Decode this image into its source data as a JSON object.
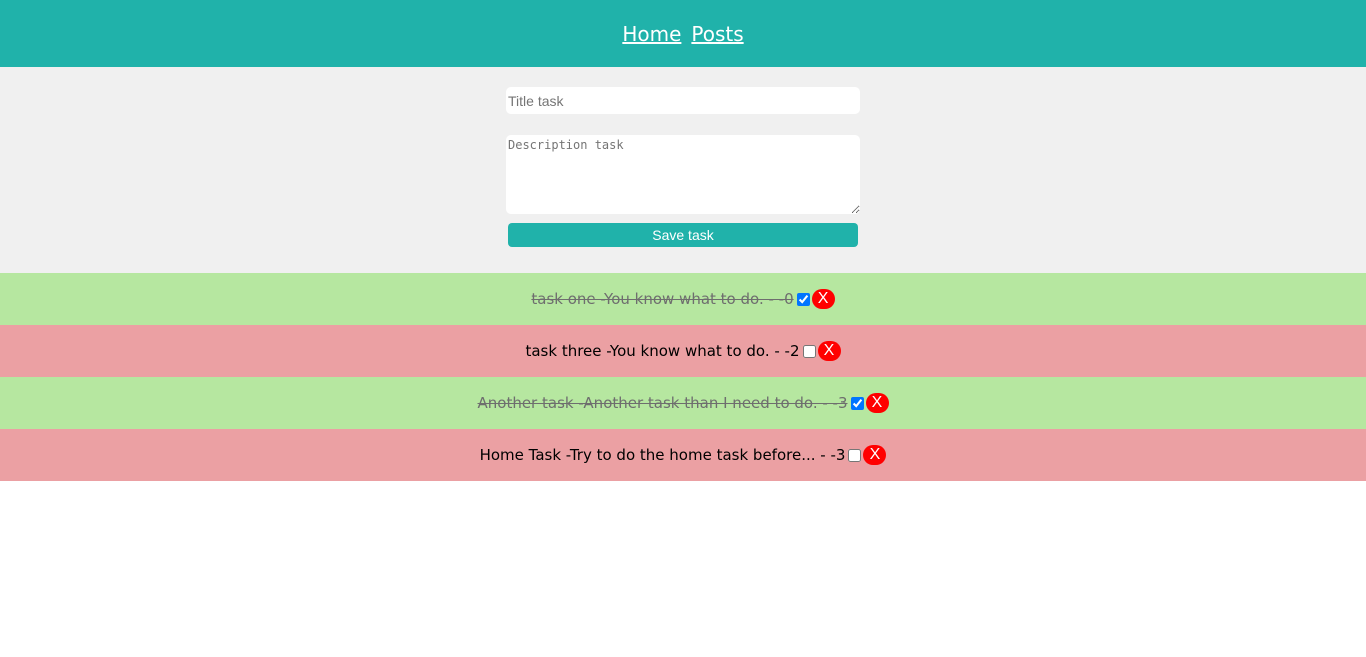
{
  "nav": {
    "home_label": "Home",
    "posts_label": "Posts"
  },
  "form": {
    "title_placeholder": "Title task",
    "description_placeholder": "Description task",
    "save_label": "Save task"
  },
  "colors": {
    "accent": "#20b2aa",
    "done_row": "#b6e7a0",
    "pending_row": "#eba0a3",
    "delete_button": "#ff0000"
  },
  "tasks": [
    {
      "text": "task one -You know what to do. - -0",
      "done": true,
      "delete_label": "X"
    },
    {
      "text": "task three -You know what to do. - -2",
      "done": false,
      "delete_label": "X"
    },
    {
      "text": "Another task -Another task than I need to do. - -3",
      "done": true,
      "delete_label": "X"
    },
    {
      "text": "Home Task -Try to do the home task before... - -3",
      "done": false,
      "delete_label": "X"
    }
  ]
}
